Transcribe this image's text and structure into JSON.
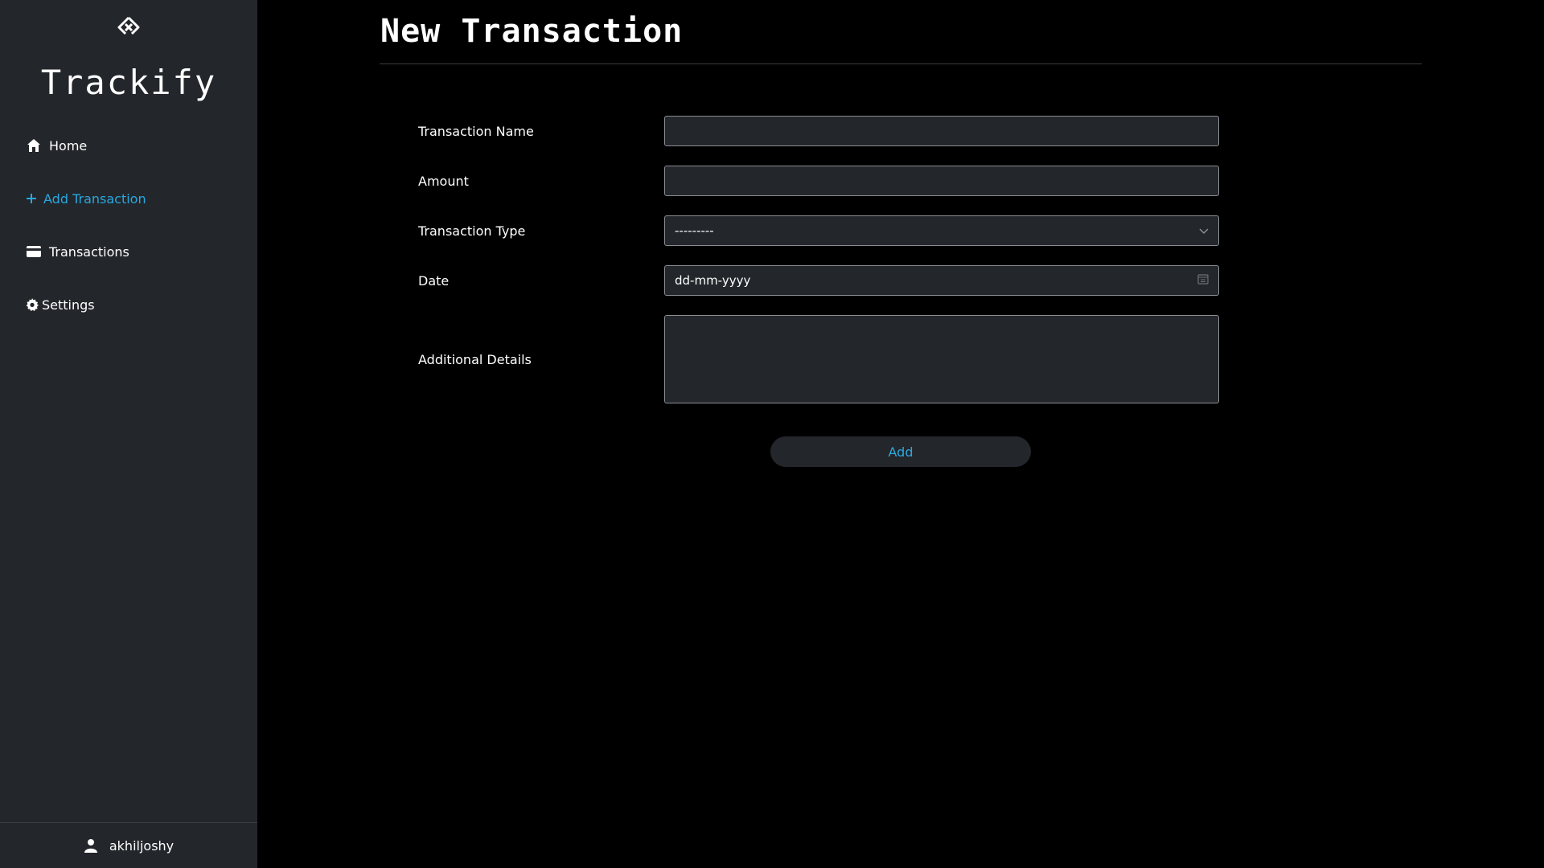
{
  "app": {
    "name": "Trackify",
    "accent_color": "#29a8e0",
    "sidebar_bg": "#23262b",
    "main_bg": "#000000"
  },
  "sidebar": {
    "items": [
      {
        "label": "Home",
        "icon": "home-icon"
      },
      {
        "label": "Add Transaction",
        "icon": "plus-icon",
        "active": true
      },
      {
        "label": "Transactions",
        "icon": "credit-card-icon"
      },
      {
        "label": "Settings",
        "icon": "gear-icon"
      }
    ],
    "user": {
      "name": "akhiljoshy",
      "icon": "user-icon"
    }
  },
  "page": {
    "title": "New Transaction"
  },
  "form": {
    "transaction_name": {
      "label": "Transaction Name",
      "value": ""
    },
    "amount": {
      "label": "Amount",
      "value": ""
    },
    "transaction_type": {
      "label": "Transaction Type",
      "selected": "---------",
      "icon": "chevron-down-icon"
    },
    "date": {
      "label": "Date",
      "placeholder": "dd-mm-yyyy",
      "icon": "calendar-icon"
    },
    "additional_details": {
      "label": "Additional Details",
      "value": ""
    },
    "submit_label": "Add"
  }
}
